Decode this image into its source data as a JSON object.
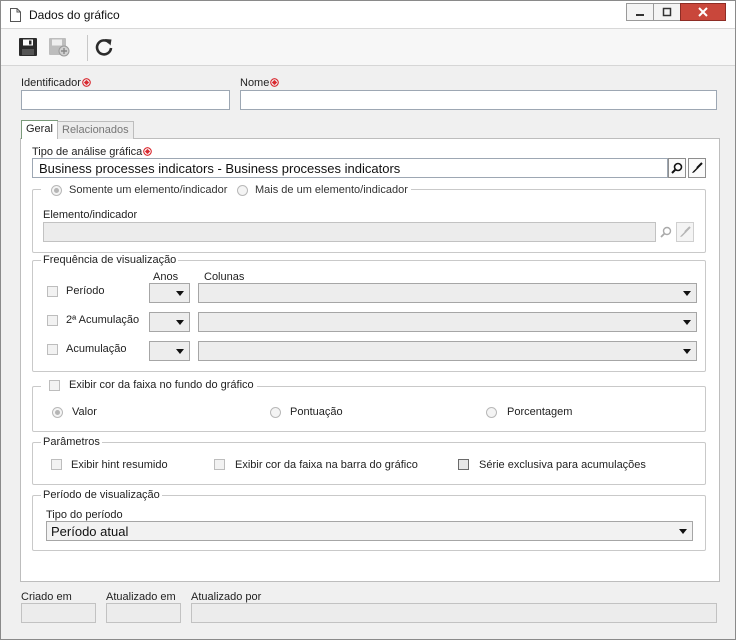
{
  "window": {
    "title": "Dados do gráfico",
    "close_color": "#c9473b"
  },
  "toolbar": {
    "icons": [
      "save-icon",
      "save-new-icon",
      "refresh-icon"
    ]
  },
  "form": {
    "identificador_label": "Identificador",
    "nome_label": "Nome",
    "identificador_value": "",
    "nome_value": ""
  },
  "tabs": {
    "geral": "Geral",
    "relacionados": "Relacionados"
  },
  "analysis": {
    "label": "Tipo de análise gráfica",
    "value": "Business processes indicators - Business processes indicators"
  },
  "element_group": {
    "option_single": "Somente um elemento/indicador",
    "option_multiple": "Mais de um elemento/indicador",
    "field_label": "Elemento/indicador",
    "field_value": ""
  },
  "frequency": {
    "legend": "Frequência de visualização",
    "col_anos": "Anos",
    "col_colunas": "Colunas",
    "rows": [
      {
        "label": "Período"
      },
      {
        "label": "2ª Acumulação"
      },
      {
        "label": "Acumulação"
      }
    ]
  },
  "band": {
    "legend": "Exibir cor da faixa no fundo do gráfico",
    "opt_valor": "Valor",
    "opt_pontuacao": "Pontuação",
    "opt_porcentagem": "Porcentagem"
  },
  "params": {
    "legend": "Parâmetros",
    "hint": "Exibir hint resumido",
    "bar_color": "Exibir cor da faixa na barra do gráfico",
    "exclusive": "Série exclusiva para acumulações"
  },
  "period": {
    "legend": "Período de visualização",
    "type_label": "Tipo do período",
    "type_value": "Período atual"
  },
  "footer": {
    "criado_em": "Criado em",
    "atualizado_em": "Atualizado em",
    "atualizado_por": "Atualizado por"
  },
  "colors": {
    "required": "#d9262d"
  }
}
